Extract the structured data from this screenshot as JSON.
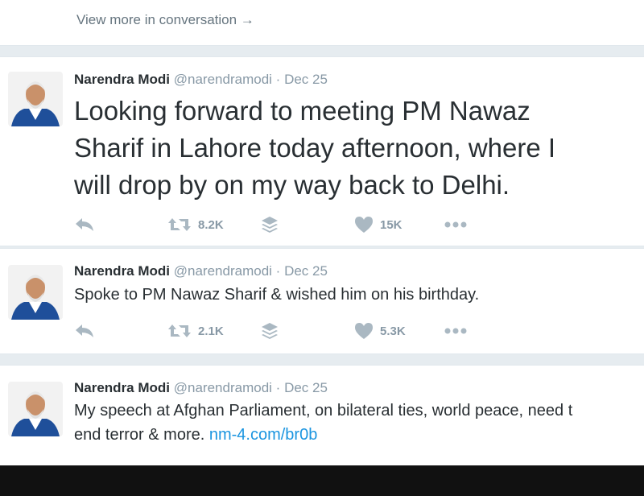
{
  "conversation": {
    "view_more": "View more in conversation →"
  },
  "tweets": [
    {
      "name": "Narendra Modi",
      "handle": "@narendramodi",
      "separator": "·",
      "date": "Dec 25",
      "lines": [
        "Looking forward to meeting PM Nawaz",
        "Sharif in Lahore today afternoon, where I",
        "will drop by on my way back to Delhi."
      ],
      "retweets": "8.2K",
      "likes": "15K"
    },
    {
      "name": "Narendra Modi",
      "handle": "@narendramodi",
      "separator": "·",
      "date": "Dec 25",
      "lines": [
        "Spoke to PM Nawaz Sharif & wished him on his birthday."
      ],
      "retweets": "2.1K",
      "likes": "5.3K"
    },
    {
      "name": "Narendra Modi",
      "handle": "@narendramodi",
      "separator": "·",
      "date": "Dec 25",
      "lines": [
        "My speech at Afghan Parliament, on bilateral ties, world peace, need t",
        "end terror & more. "
      ],
      "link": "nm-4.com/br0b"
    }
  ],
  "icons": {
    "reply": "reply-icon",
    "retweet": "retweet-icon",
    "buffer": "layers-icon",
    "like": "heart-icon",
    "more": "more-dots-icon"
  },
  "colors": {
    "background": "#e6ecf0",
    "text": "#292f33",
    "muted": "#8899a6",
    "link": "#1b95e0",
    "icon": "#aab8c2"
  }
}
